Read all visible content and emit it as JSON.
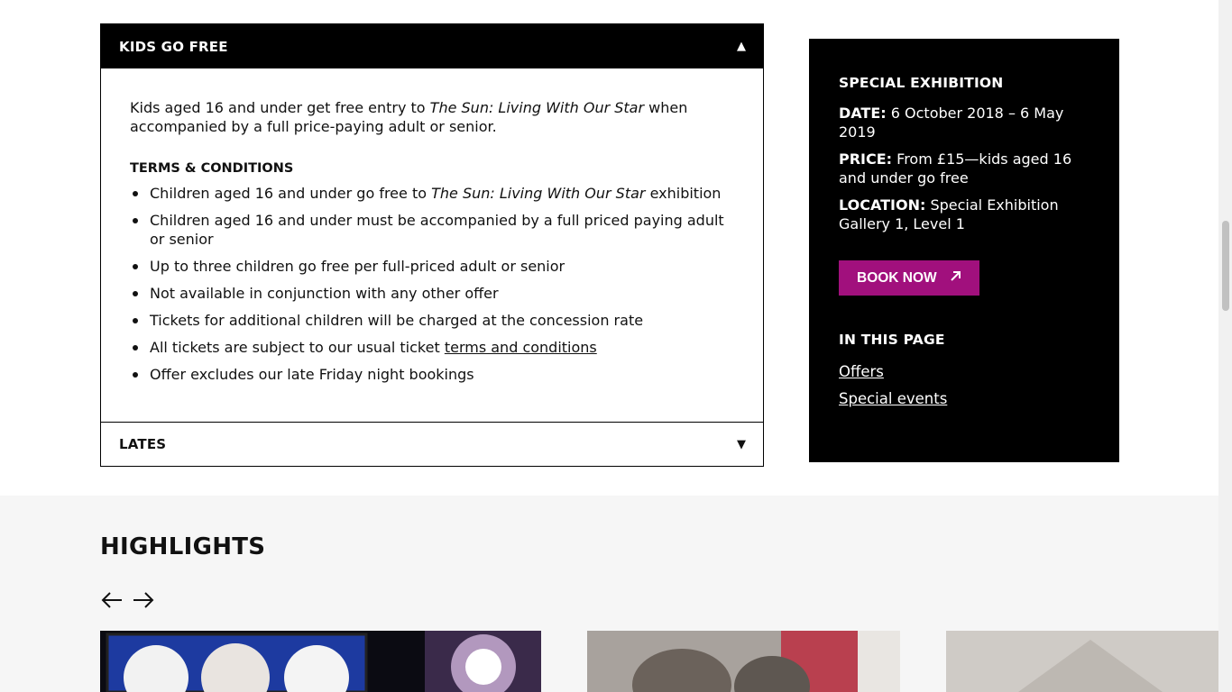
{
  "kids_go_free": {
    "title": "KIDS GO FREE",
    "intro_1": "Kids aged 16 and under get free entry to ",
    "intro_exhibit": "The Sun: Living With Our Star",
    "intro_2": " when accompanied by a full price-paying adult or senior.",
    "terms_title": "TERMS & CONDITIONS",
    "terms": {
      "item1_a": "Children aged 16 and under go free to ",
      "item1_exhibit": "The Sun: Living With Our Star",
      "item1_b": " exhibition",
      "item2": "Children aged 16 and under must be accompanied by a full priced paying adult or senior",
      "item3": "Up to three children go free per full-priced adult or senior",
      "item4": "Not available in conjunction with any other offer",
      "item5": "Tickets for additional children will be charged at the concession rate",
      "item6_a": "All tickets are subject to our usual ticket ",
      "item6_link": "terms and conditions",
      "item7": "Offer excludes our late Friday night bookings"
    }
  },
  "lates": {
    "title": "LATES"
  },
  "panel": {
    "heading": "SPECIAL EXHIBITION",
    "date_label": "DATE:",
    "date_value": " 6 October 2018 – 6 May 2019",
    "price_label": "PRICE:",
    "price_value": " From £15—kids aged 16 and under go free",
    "location_label": "LOCATION:",
    "location_value": " Special Exhibition Gallery 1, Level 1",
    "book_label": "BOOK NOW",
    "in_page_heading": "IN THIS PAGE",
    "links": [
      "Offers",
      "Special events"
    ]
  },
  "highlights": {
    "title": "HIGHLIGHTS"
  },
  "icons": {
    "collapse": "triangle-up-icon",
    "expand": "triangle-down-icon",
    "external": "arrow-up-right-icon",
    "prev": "arrow-left-icon",
    "next": "arrow-right-icon"
  },
  "colors": {
    "accent": "#a1107d",
    "panel_bg": "#000000",
    "highlights_bg": "#f6f6f6"
  }
}
